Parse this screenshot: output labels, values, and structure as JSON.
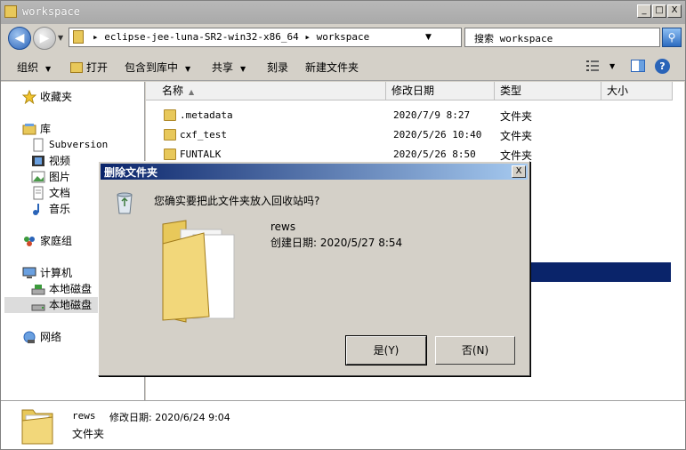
{
  "window": {
    "title": "workspace",
    "min_glyph": "_",
    "max_glyph": "□",
    "close_glyph": "X"
  },
  "address": {
    "path_text": "▸ eclipse-jee-luna-SR2-win32-x86_64 ▸ workspace",
    "search_placeholder": "搜索 workspace"
  },
  "toolbar": {
    "organize": "组织",
    "open": "打开",
    "include_in_library": "包含到库中",
    "share": "共享",
    "burn": "刻录",
    "new_folder": "新建文件夹"
  },
  "nav": {
    "favorites": "收藏夹",
    "libraries": "库",
    "subversion": "Subversion",
    "videos": "视频",
    "pictures": "图片",
    "documents": "文档",
    "music": "音乐",
    "homegroup": "家庭组",
    "computer": "计算机",
    "local_disk_1": "本地磁盘",
    "local_disk_2": "本地磁盘",
    "network": "网络"
  },
  "columns": {
    "name": "名称",
    "date_modified": "修改日期",
    "type": "类型",
    "size": "大小"
  },
  "files": [
    {
      "name": ".metadata",
      "date": "2020/7/9 8:27",
      "type": "文件夹"
    },
    {
      "name": "cxf_test",
      "date": "2020/5/26 10:40",
      "type": "文件夹"
    },
    {
      "name": "FUNTALK",
      "date": "2020/5/26 8:50",
      "type": "文件夹"
    }
  ],
  "details": {
    "name": "rews",
    "modified": "修改日期: 2020/6/24 9:04",
    "type": "文件夹"
  },
  "dialog": {
    "title": "删除文件夹",
    "question": "您确实要把此文件夹放入回收站吗?",
    "folder_name": "rews",
    "created": "创建日期: 2020/5/27 8:54",
    "yes": "是(Y)",
    "no": "否(N)",
    "close_glyph": "X"
  },
  "colors": {
    "selection": "#0a246a",
    "dialog_title_start": "#0a246a",
    "folder": "#e8c85a"
  }
}
